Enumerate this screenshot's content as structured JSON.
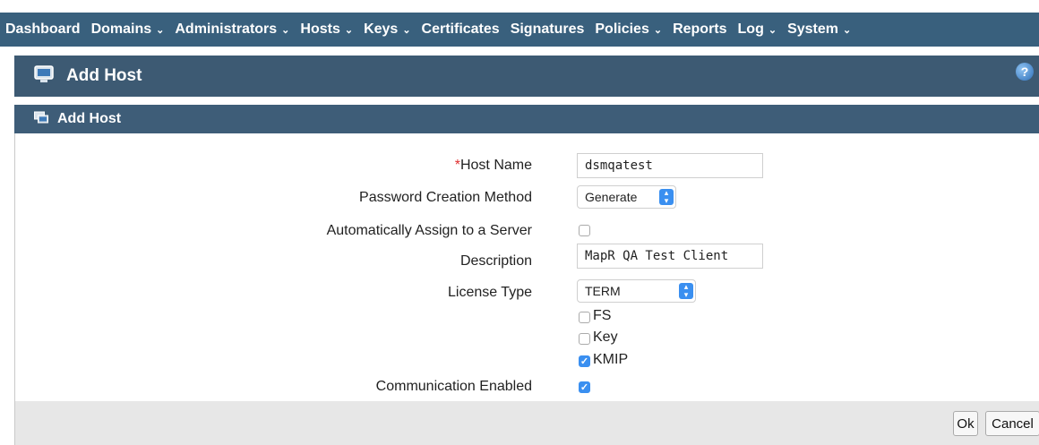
{
  "nav": {
    "items": [
      {
        "label": "Dashboard",
        "caret": false
      },
      {
        "label": "Domains",
        "caret": true
      },
      {
        "label": "Administrators",
        "caret": true
      },
      {
        "label": "Hosts",
        "caret": true
      },
      {
        "label": "Keys",
        "caret": true
      },
      {
        "label": "Certificates",
        "caret": false
      },
      {
        "label": "Signatures",
        "caret": false
      },
      {
        "label": "Policies",
        "caret": true
      },
      {
        "label": "Reports",
        "caret": false
      },
      {
        "label": "Log",
        "caret": true
      },
      {
        "label": "System",
        "caret": true
      }
    ]
  },
  "header": {
    "title": "Add Host",
    "help": "?"
  },
  "section": {
    "title": "Add Host"
  },
  "form": {
    "host_name": {
      "required_mark": "*",
      "label": "Host Name",
      "value": "dsmqatest"
    },
    "password_method": {
      "label": "Password Creation Method",
      "value": "Generate"
    },
    "auto_assign": {
      "label": "Automatically Assign to a Server",
      "checked": false
    },
    "description": {
      "label": "Description",
      "value": "MapR QA Test Client"
    },
    "license_type": {
      "label": "License Type",
      "value": "TERM",
      "options": [
        {
          "label": "FS",
          "checked": false
        },
        {
          "label": "Key",
          "checked": false
        },
        {
          "label": "KMIP",
          "checked": true
        }
      ]
    },
    "communication": {
      "label": "Communication Enabled",
      "checked": true
    }
  },
  "footer": {
    "ok_label": "Ok",
    "cancel_label": "Cancel"
  },
  "colors": {
    "navbar": "#39607d",
    "header": "#3d5a73",
    "accent": "#3a8ff0"
  }
}
